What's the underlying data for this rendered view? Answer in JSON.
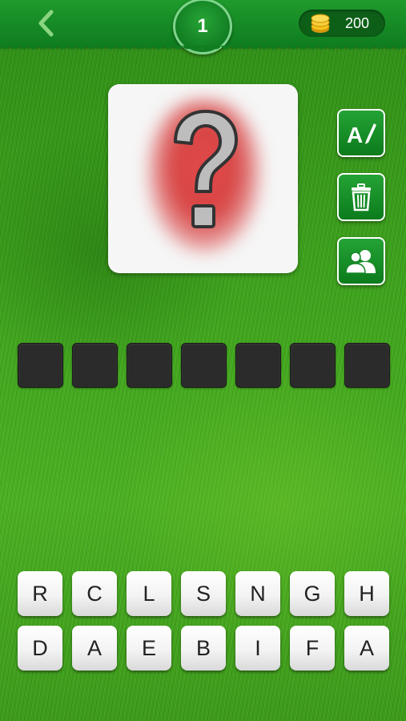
{
  "header": {
    "back_icon": "chevron-left-icon",
    "level": "1",
    "coin_icon": "coin-stack-icon",
    "coins": "200"
  },
  "puzzle": {
    "image_icon": "question-mark-icon",
    "answer_length": 7
  },
  "side_buttons": [
    {
      "name": "reveal-letter-button",
      "icon": "letter-pencil-icon"
    },
    {
      "name": "remove-letters-button",
      "icon": "trash-icon"
    },
    {
      "name": "ask-friends-button",
      "icon": "users-icon"
    }
  ],
  "letters": {
    "row1": [
      "R",
      "C",
      "L",
      "S",
      "N",
      "G",
      "H"
    ],
    "row2": [
      "D",
      "A",
      "E",
      "B",
      "I",
      "F",
      "A"
    ]
  },
  "colors": {
    "header_green": "#1a8f28",
    "slot_dark": "#2b2b2b",
    "tile_white": "#ffffff",
    "coin_gold": "#f4c21b"
  }
}
